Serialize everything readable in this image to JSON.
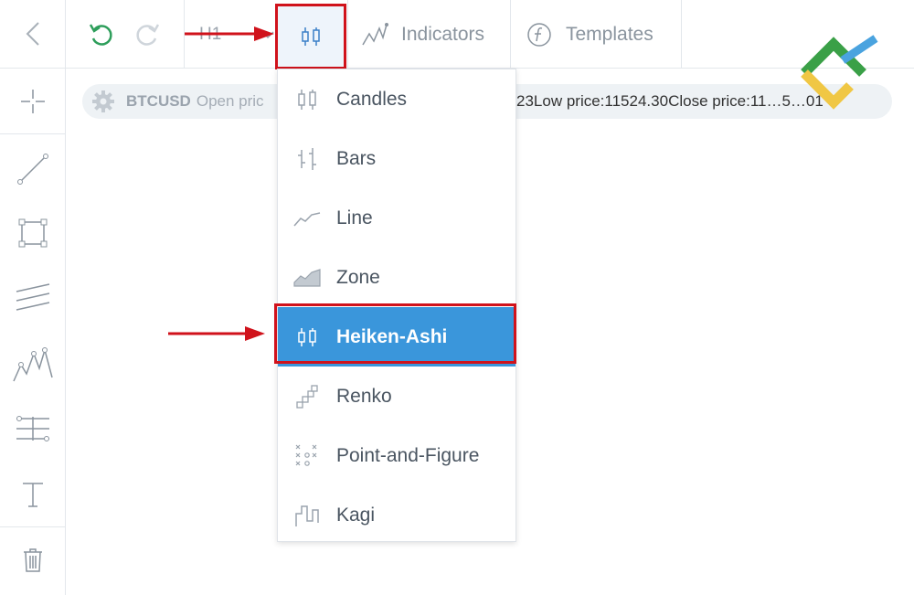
{
  "toolbar": {
    "timeframe": "H1",
    "indicators_label": "Indicators",
    "templates_label": "Templates"
  },
  "info_bar": {
    "symbol": "BTCUSD",
    "open_label": "Open pric",
    "high_tail": "23",
    "low_label": "Low price:",
    "low_value": "11524.30",
    "close_label": "Close price:",
    "close_value": "11…5…01"
  },
  "chart_type_menu": {
    "items": [
      {
        "label": "Candles",
        "icon": "candles-icon"
      },
      {
        "label": "Bars",
        "icon": "bars-icon"
      },
      {
        "label": "Line",
        "icon": "line-chart-icon"
      },
      {
        "label": "Zone",
        "icon": "zone-chart-icon"
      },
      {
        "label": "Heiken-Ashi",
        "icon": "heiken-ashi-icon",
        "selected": true
      },
      {
        "label": "Renko",
        "icon": "renko-icon"
      },
      {
        "label": "Point-and-Figure",
        "icon": "point-and-figure-icon"
      },
      {
        "label": "Kagi",
        "icon": "kagi-icon"
      }
    ]
  },
  "colors": {
    "highlight_red": "#d0121b",
    "selected_blue": "#3a96db",
    "green_value": "#4fbf80",
    "undo_green": "#2e9e5b"
  }
}
